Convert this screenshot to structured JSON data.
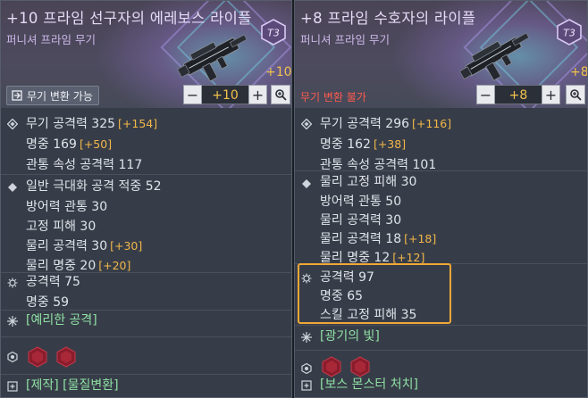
{
  "left": {
    "title": "+10 프라임 선구자의 에레보스 라이플",
    "subtitle": "퍼니셔 프라임 무기",
    "tier_badge": "T3",
    "plus_level": "+10",
    "convert_label": "무기 변환 가능",
    "stepper_value": "+10",
    "groups": {
      "weapon": [
        {
          "text": "무기 공격력 325",
          "bonus": "[+154]"
        },
        {
          "text": "명중 169",
          "bonus": "[+50]"
        },
        {
          "text": "관통 속성 공격력 117",
          "bonus": ""
        }
      ],
      "option": [
        {
          "text": "일반 극대화 공격 적중 52",
          "bonus": ""
        },
        {
          "text": "방어력 관통 30",
          "bonus": ""
        },
        {
          "text": "고정 피해 30",
          "bonus": ""
        },
        {
          "text": "물리 공격력 30",
          "bonus": "[+30]"
        },
        {
          "text": "물리 명중 20",
          "bonus": "[+20]"
        }
      ],
      "set": [
        {
          "text": "공격력 75"
        },
        {
          "text": "명중 59"
        }
      ],
      "skill": "[예리한 공격]",
      "source": "[제작] [물질변환]"
    }
  },
  "right": {
    "title": "+8 프라임 수호자의 라이플",
    "subtitle": "퍼니셔 프라임 무기",
    "tier_badge": "T3",
    "plus_level": "+8",
    "convert_label": "무기 변환 불가",
    "stepper_value": "+8",
    "groups": {
      "weapon": [
        {
          "text": "무기 공격력 296",
          "bonus": "[+116]"
        },
        {
          "text": "명중 162",
          "bonus": "[+38]"
        },
        {
          "text": "관통 속성 공격력 101",
          "bonus": ""
        }
      ],
      "option": [
        {
          "text": "물리 고정 피해 30",
          "bonus": ""
        },
        {
          "text": "방어력 관통 50",
          "bonus": ""
        },
        {
          "text": "물리 공격력 30",
          "bonus": ""
        },
        {
          "text": "물리 공격력 18",
          "bonus": "[+18]"
        },
        {
          "text": "물리 명중 12",
          "bonus": "[+12]"
        }
      ],
      "set": [
        {
          "text": "공격력 97"
        },
        {
          "text": "명중 65"
        },
        {
          "text": "스킬 고정 피해 35"
        }
      ],
      "skill": "[광기의 빛]",
      "source": "[보스 몬스터 처치]"
    }
  },
  "stepper_minus": "−",
  "stepper_plus": "+",
  "icons": [
    "tier-badge-icon",
    "weapon-stat-icon",
    "option-stat-icon",
    "set-stat-icon",
    "skill-icon",
    "gem-slot-icon",
    "source-icon",
    "zoom-icon",
    "convert-icon"
  ],
  "colors": {
    "bonus": "#f2b74a",
    "plus_level": "#f2c24c",
    "skill_text": "#8fe0a4",
    "convert_disabled": "#ff5a4e",
    "highlight": "#f0a836",
    "gem": "#b8263a"
  }
}
